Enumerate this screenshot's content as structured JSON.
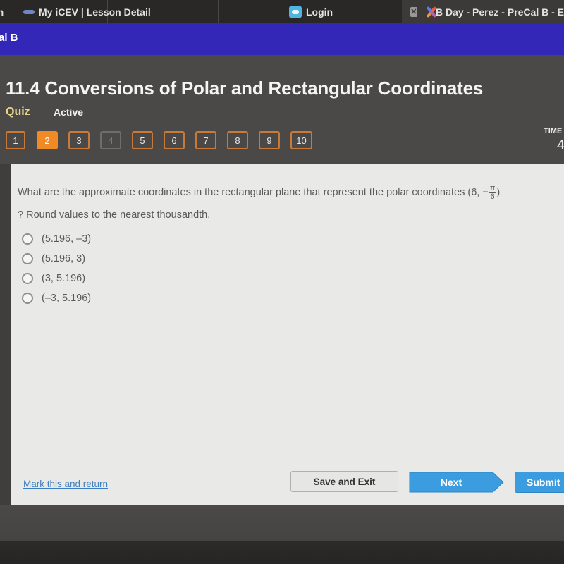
{
  "browser": {
    "tabs": [
      {
        "label": "th",
        "icon": "none",
        "active": false
      },
      {
        "label": "My iCEV | Lesson Detail",
        "icon": "icev-logo-icon",
        "active": false
      },
      {
        "label": "Login",
        "icon": "cloud-icon",
        "active": false
      },
      {
        "label": "B Day - Perez - PreCal B - E",
        "icon": "x-logo-icon",
        "active": true
      }
    ],
    "close_glyph": "✕"
  },
  "app": {
    "course_title": "al B"
  },
  "quiz": {
    "title": "11.4 Conversions of Polar and Rectangular Coordinates",
    "type_label": "Quiz",
    "status": "Active",
    "timer_label": "TIME",
    "timer_value": "4",
    "current_question": 2,
    "questions": [
      {
        "number": "1",
        "state": "answered"
      },
      {
        "number": "2",
        "state": "current"
      },
      {
        "number": "3",
        "state": "answered"
      },
      {
        "number": "4",
        "state": "disabled"
      },
      {
        "number": "5",
        "state": "answered"
      },
      {
        "number": "6",
        "state": "answered"
      },
      {
        "number": "7",
        "state": "answered"
      },
      {
        "number": "8",
        "state": "answered"
      },
      {
        "number": "9",
        "state": "answered"
      },
      {
        "number": "10",
        "state": "answered"
      }
    ]
  },
  "question": {
    "text_before": "What are the approximate coordinates in the rectangular plane that represent the polar coordinates (6, −",
    "frac_num": "π",
    "frac_den": "6",
    "text_after": ")",
    "text_line2": "? Round values to the nearest thousandth.",
    "options": [
      {
        "label": "(5.196, –3)",
        "selected": false
      },
      {
        "label": "(5.196, 3)",
        "selected": false
      },
      {
        "label": "(3, 5.196)",
        "selected": false
      },
      {
        "label": "(–3, 5.196)",
        "selected": false
      }
    ]
  },
  "footer": {
    "mark_link": "Mark this and return",
    "save_label": "Save and Exit",
    "next_label": "Next",
    "submit_label": "Submit"
  },
  "colors": {
    "app_band": "#3327b8",
    "accent_orange": "#f08a24",
    "button_blue": "#3b9de0",
    "link_blue": "#3e7fc0"
  }
}
